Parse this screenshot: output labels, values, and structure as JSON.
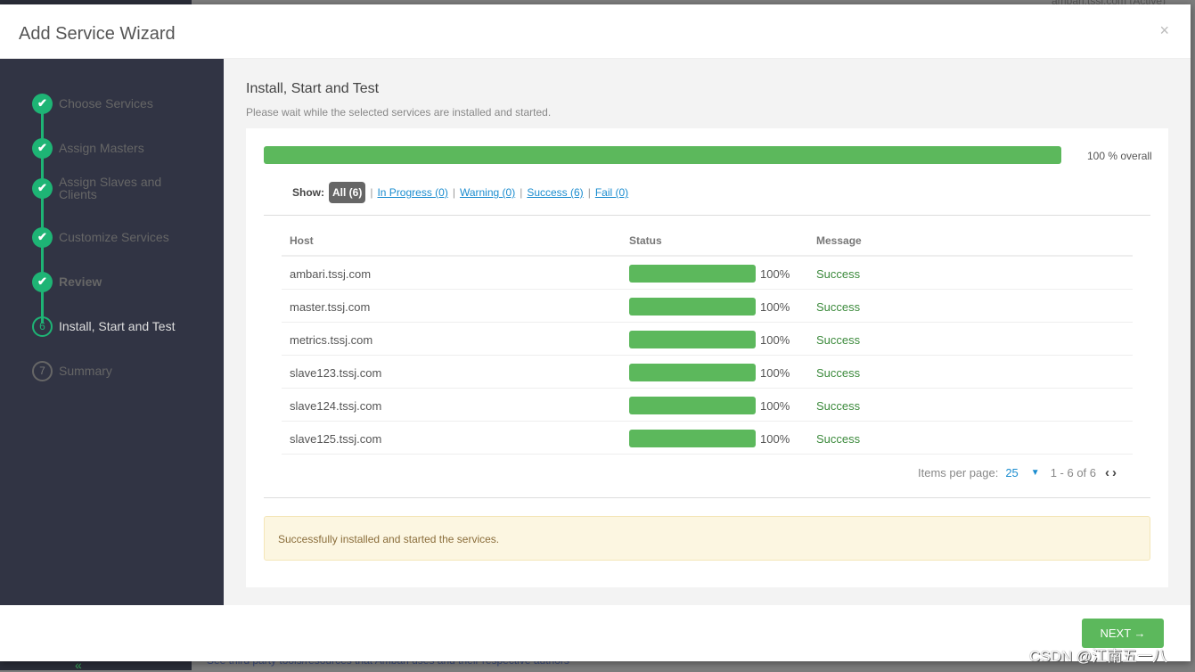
{
  "background": {
    "top_text": "ambari.tssj.com (Active)",
    "footer_text": "See third party tools/resources that Ambari uses and their respective authors"
  },
  "modal": {
    "title": "Add Service Wizard",
    "close": "×"
  },
  "steps": [
    {
      "label": "Choose Services",
      "state": "done",
      "icon": "check"
    },
    {
      "label": "Assign Masters",
      "state": "done",
      "icon": "check"
    },
    {
      "label": "Assign Slaves and Clients",
      "state": "done",
      "icon": "check"
    },
    {
      "label": "Customize Services",
      "state": "done",
      "icon": "check"
    },
    {
      "label": "Review",
      "state": "done",
      "icon": "check"
    },
    {
      "label": "Install, Start and Test",
      "state": "current",
      "number": "6"
    },
    {
      "label": "Summary",
      "state": "future",
      "number": "7"
    }
  ],
  "main": {
    "title": "Install, Start and Test",
    "subtitle": "Please wait while the selected services are installed and started.",
    "overall_progress": 100,
    "overall_label": "100 % overall"
  },
  "filters": {
    "show_label": "Show:",
    "items": [
      "All (6)",
      "In Progress (0)",
      "Warning (0)",
      "Success (6)",
      "Fail (0)"
    ]
  },
  "table": {
    "headers": [
      "Host",
      "Status",
      "Message"
    ],
    "rows": [
      {
        "host": "ambari.tssj.com",
        "progress": 100,
        "pct": "100%",
        "message": "Success"
      },
      {
        "host": "master.tssj.com",
        "progress": 100,
        "pct": "100%",
        "message": "Success"
      },
      {
        "host": "metrics.tssj.com",
        "progress": 100,
        "pct": "100%",
        "message": "Success"
      },
      {
        "host": "slave123.tssj.com",
        "progress": 100,
        "pct": "100%",
        "message": "Success"
      },
      {
        "host": "slave124.tssj.com",
        "progress": 100,
        "pct": "100%",
        "message": "Success"
      },
      {
        "host": "slave125.tssj.com",
        "progress": 100,
        "pct": "100%",
        "message": "Success"
      }
    ]
  },
  "pagination": {
    "items_per_page_label": "Items per page:",
    "items_per_page": "25",
    "range": "1 - 6 of 6"
  },
  "alert": "Successfully installed and started the services.",
  "next_button": "NEXT →",
  "watermark": "CSDN @江南五一八",
  "colors": {
    "accent": "#1eb475",
    "progress": "#5cb85c",
    "sidebar": "#313444",
    "link": "#1a8ccf"
  }
}
